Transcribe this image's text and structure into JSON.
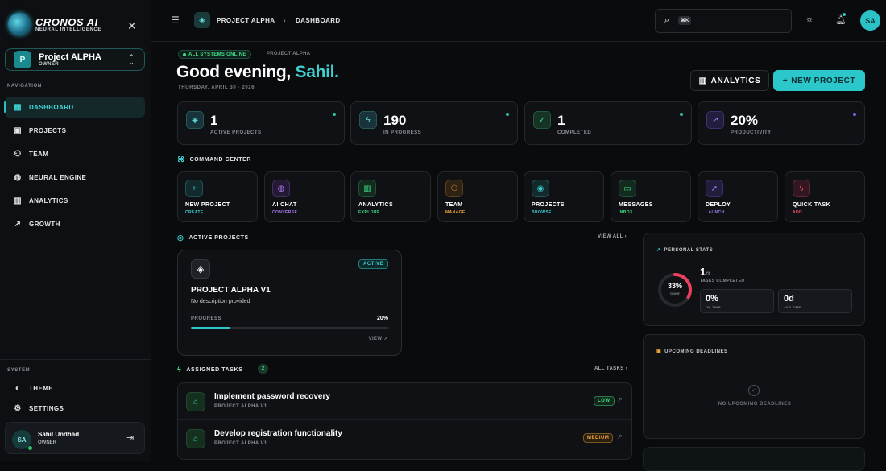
{
  "brand": {
    "name": "CRONOS AI",
    "tagline": "NEURAL INTELLIGENCE"
  },
  "project_selector": {
    "initial": "P",
    "name": "Project ALPHA",
    "role": "OWNER"
  },
  "sidebar": {
    "nav_label": "NAVIGATION",
    "items": [
      {
        "label": "DASHBOARD",
        "icon": "grid-icon",
        "active": true
      },
      {
        "label": "PROJECTS",
        "icon": "briefcase-icon"
      },
      {
        "label": "TEAM",
        "icon": "users-icon"
      },
      {
        "label": "NEURAL ENGINE",
        "icon": "brain-icon"
      },
      {
        "label": "ANALYTICS",
        "icon": "bar-chart-icon"
      },
      {
        "label": "GROWTH",
        "icon": "trending-up-icon"
      }
    ],
    "system_label": "SYSTEM",
    "system_items": [
      {
        "label": "THEME",
        "icon": "palette-icon"
      },
      {
        "label": "SETTINGS",
        "icon": "gear-icon"
      }
    ]
  },
  "user": {
    "initials": "SA",
    "name": "Sahil Undhad",
    "role": "OWNER"
  },
  "topbar": {
    "crumb_project": "PROJECT ALPHA",
    "crumb_sep": "›",
    "crumb_page": "DASHBOARD",
    "search_kbd": "⌘K",
    "avatar": "SA"
  },
  "header": {
    "status": "ALL SYSTEMS ONLINE",
    "status_project": "PROJECT ALPHA",
    "greeting": "Good evening, ",
    "name": "Sahil",
    "period": ".",
    "date": "THURSDAY, APRIL 30 · 2026",
    "analytics_btn": "ANALYTICS",
    "new_project_btn": "NEW PROJECT"
  },
  "stats": [
    {
      "value": "1",
      "label": "ACTIVE PROJECTS",
      "icon": "layers-icon",
      "dot": "#2bc7a8"
    },
    {
      "value": "190",
      "label": "IN PROGRESS",
      "icon": "bolt-icon",
      "dot": "#2bc7a8"
    },
    {
      "value": "1",
      "label": "COMPLETED",
      "icon": "check-circle-icon",
      "dot": "#2bc7a8"
    },
    {
      "value": "20%",
      "label": "PRODUCTIVITY",
      "icon": "trending-up-icon",
      "dot": "#7b6cf6"
    }
  ],
  "command_center": {
    "title": "COMMAND CENTER",
    "items": [
      {
        "title": "NEW PROJECT",
        "sub": "CREATE",
        "color": "#3ecfd0",
        "icon": "plus-icon"
      },
      {
        "title": "AI CHAT",
        "sub": "CONVERSE",
        "color": "#b07cf0",
        "icon": "brain-icon"
      },
      {
        "title": "ANALYTICS",
        "sub": "EXPLORE",
        "color": "#3fdf88",
        "icon": "bar-chart-icon"
      },
      {
        "title": "TEAM",
        "sub": "MANAGE",
        "color": "#f0a53c",
        "icon": "users-icon"
      },
      {
        "title": "PROJECTS",
        "sub": "BROWSE",
        "color": "#3ecfd0",
        "icon": "folder-icon"
      },
      {
        "title": "MESSAGES",
        "sub": "INBOX",
        "color": "#3fdf88",
        "icon": "message-icon"
      },
      {
        "title": "DEPLOY",
        "sub": "LAUNCH",
        "color": "#9b7cf6",
        "icon": "rocket-icon"
      },
      {
        "title": "QUICK TASK",
        "sub": "ADD",
        "color": "#f0506e",
        "icon": "bolt-icon"
      }
    ]
  },
  "active_projects": {
    "title": "ACTIVE PROJECTS",
    "view_all": "VIEW ALL ›",
    "card": {
      "badge": "ACTIVE",
      "name": "PROJECT ALPHA V1",
      "description": "No description provided",
      "progress_label": "PROGRESS",
      "progress": "20%",
      "progress_value": 0.2,
      "view": "VIEW ↗"
    }
  },
  "assigned_tasks": {
    "title": "ASSIGNED TASKS",
    "count": "2",
    "all": "ALL TASKS ›",
    "rows": [
      {
        "title": "Implement password recovery",
        "project": "PROJECT ALPHA V1",
        "priority": "LOW",
        "color": "#3fdf88"
      },
      {
        "title": "Develop registration functionality",
        "project": "PROJECT ALPHA V1",
        "priority": "MEDIUM",
        "color": "#f0a53c"
      }
    ]
  },
  "personal_stats": {
    "title": "PERSONAL STATS",
    "ring_pct": "33%",
    "ring_value": 0.33,
    "ring_sub": "DONE",
    "done": "1",
    "total": "/3",
    "done_label": "TASKS COMPLETED",
    "on_time": "0%",
    "on_time_label": "ON-TIME",
    "avg": "0d",
    "avg_label": "AVG TIME"
  },
  "deadlines": {
    "title": "UPCOMING DEADLINES",
    "empty": "NO UPCOMING DEADLINES"
  }
}
